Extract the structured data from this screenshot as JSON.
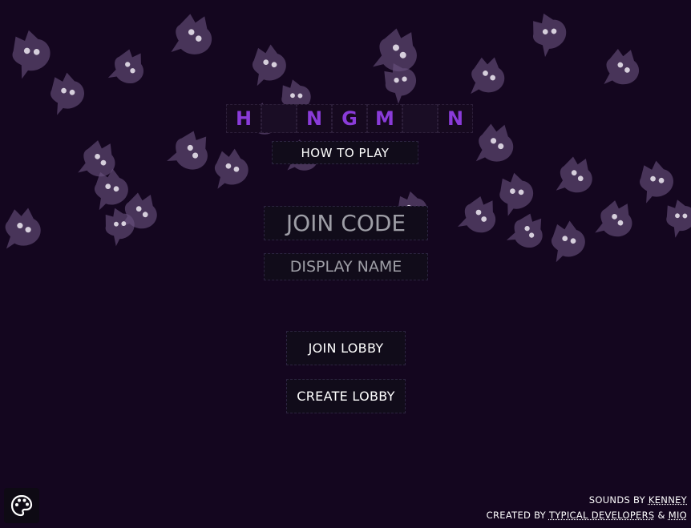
{
  "theme": {
    "background": "#14061f",
    "ghost_color": "#6a5480",
    "title_letter_color": "#8a3bd9",
    "button_bg": "#110c1a"
  },
  "title": {
    "tiles": [
      "H",
      "",
      "N",
      "G",
      "M",
      "",
      "N"
    ]
  },
  "how_to_play": {
    "label": "HOW TO PLAY"
  },
  "form": {
    "join_code": {
      "value": "",
      "placeholder": "JOIN CODE"
    },
    "display_name": {
      "value": "",
      "placeholder": "DISPLAY NAME"
    }
  },
  "actions": {
    "join_label": "JOIN LOBBY",
    "create_label": "CREATE LOBBY"
  },
  "theme_button": {
    "icon": "palette-icon"
  },
  "credits": {
    "sounds_prefix": "SOUNDS BY",
    "sounds_author": "KENNEY",
    "created_prefix": "CREATED BY",
    "created_author": "TYPICAL DEVELOPERS",
    "created_joiner": "&",
    "created_author2": "MIO"
  }
}
